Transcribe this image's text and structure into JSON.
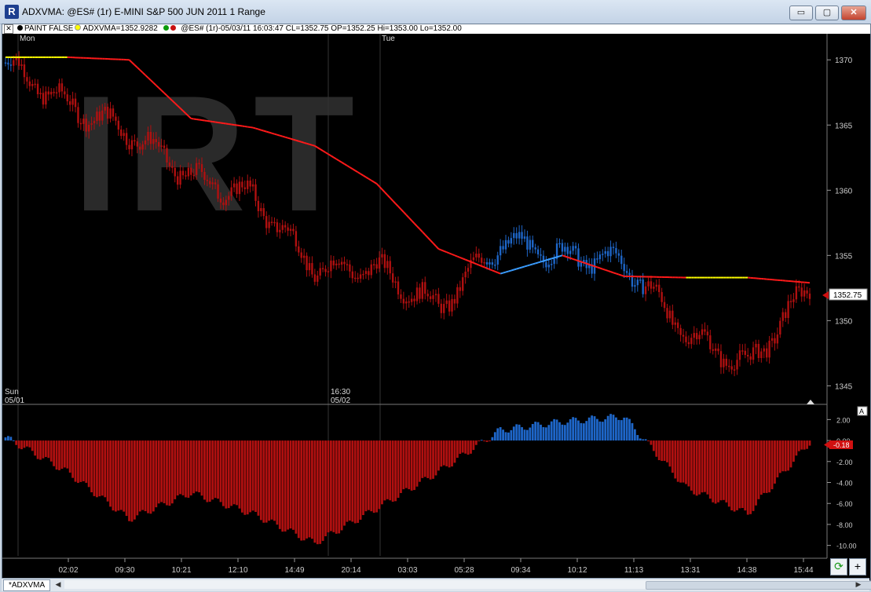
{
  "window": {
    "title": "ADXVMA: @ES# (1r) E-MINI S&P 500 JUN 2011 1 Range",
    "minimize_label": "▭",
    "maximize_label": "▢",
    "close_label": "✕"
  },
  "infobar": {
    "close_label": "✕",
    "paint": "PAINT FALSE",
    "adxvma": "ADXVMA=1352.9282",
    "quote": "@ES# (1r)-05/03/11 16:03:47 CL=1352.75 OP=1352.25 Hi=1353.00 Lo=1352.00"
  },
  "chart": {
    "watermark": "IRT",
    "day_labels": [
      "Mon",
      "Tue"
    ],
    "date_labels": [
      {
        "top": "Sun",
        "bottom": "05/01"
      },
      {
        "top": "16:30",
        "bottom": "05/02"
      }
    ],
    "price_ticks": [
      "1370",
      "1365",
      "1360",
      "1355",
      "1350",
      "1345"
    ],
    "last_price": "1352.75",
    "scale_mode": "A",
    "osc_ticks": [
      "2.00",
      "0.00",
      "-2.00",
      "-4.00",
      "-6.00",
      "-8.00",
      "-10.00"
    ],
    "osc_last": "-0.18",
    "time_ticks": [
      "02:02",
      "09:30",
      "10:21",
      "12:10",
      "14:49",
      "20:14",
      "03:03",
      "05:28",
      "09:34",
      "10:12",
      "11:13",
      "13:31",
      "14:38",
      "15:44"
    ]
  },
  "chart_data": {
    "type": "line",
    "title": "ADXVMA: @ES# (1r) E-MINI S&P 500 JUN 2011 1 Range",
    "x": [
      "02:02",
      "09:30",
      "10:21",
      "12:10",
      "14:49",
      "20:14",
      "03:03",
      "05:28",
      "09:34",
      "10:12",
      "11:13",
      "13:31",
      "14:38",
      "15:44"
    ],
    "price_ylim": [
      1344,
      1372
    ],
    "series": [
      {
        "name": "ADXVMA",
        "values": [
          1370.2,
          1370.2,
          1370.0,
          1365.5,
          1364.8,
          1363.4,
          1360.5,
          1355.5,
          1353.6,
          1355.0,
          1353.4,
          1353.3,
          1353.3,
          1352.9
        ]
      },
      {
        "values": [
          1369.8,
          1366.5,
          1364.5,
          1361.0,
          1359.5,
          1354.0,
          1354.0,
          1351.0,
          1356.0,
          1355.0,
          1354.5,
          1349.0,
          1346.5,
          1352.75
        ]
      }
    ],
    "oscillator": {
      "ylim": [
        -11,
        3
      ],
      "values": [
        0.3,
        -3.0,
        -7.5,
        -5.0,
        -7.0,
        -9.8,
        -6.5,
        -3.0,
        1.0,
        1.8,
        2.3,
        -4.5,
        -7.0,
        -0.18
      ]
    },
    "last_price": 1352.75,
    "osc_last": -0.18,
    "colors": {
      "up": "#1e66c8",
      "down": "#b01010",
      "neutral": "#ffff00",
      "line_down": "#ff1a1a",
      "line_up": "#3a9cff"
    }
  },
  "bottom": {
    "tab_label": "*ADXVMA",
    "scroll_left": "◀",
    "scroll_right": "▶",
    "refresh_icon": "⟳",
    "add_icon": "+"
  }
}
